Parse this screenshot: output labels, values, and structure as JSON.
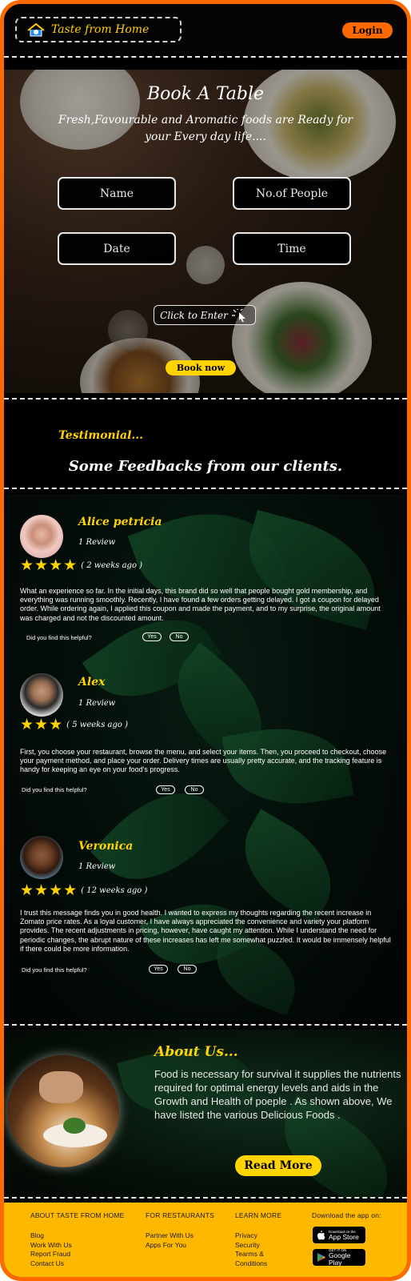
{
  "header": {
    "brand": "Taste from Home",
    "login": "Login"
  },
  "booking": {
    "title": "Book A Table",
    "subtitle": "Fresh,Favourable and Aromatic foods are Ready for your Every day life....",
    "fields": {
      "name": "Name",
      "people": "No.of People",
      "date": "Date",
      "time": "Time"
    },
    "enter": "Click to Enter",
    "book": "Book now"
  },
  "testimonial": {
    "label": "Testimonial...",
    "title": "Some Feedbacks from our clients.",
    "helpful_q": "Did you find this helpful?",
    "yes": "Yes",
    "no": "No",
    "reviews": [
      {
        "name": "Alice petricia",
        "count": "1 Review",
        "stars": 4,
        "time": "( 2 weeks ago )",
        "text": "What an experience so far. In the initial days, this brand did so well that people bought gold membership, and everything was running smoothly.  Recently, I have found a few orders getting delayed. I got a coupon for delayed order. While ordering again, I applied this coupon and made the payment, and to my surprise, the original amount was charged and not the discounted amount."
      },
      {
        "name": "Alex",
        "count": "1 Review",
        "stars": 3,
        "time": "( 5 weeks ago )",
        "text": " First, you choose your restaurant, browse the menu, and select your items. Then, you proceed to checkout, choose your payment method, and place your order. Delivery times are usually pretty accurate, and the tracking feature is handy for keeping an eye on your food's progress."
      },
      {
        "name": "Veronica",
        "count": "1 Review",
        "stars": 4,
        "time": "( 12 weeks ago )",
        "text": "I trust this message finds you in good health. I wanted to express my thoughts regarding the recent increase in Zomato price rates. As a loyal customer, I have always appreciated the convenience and variety your platform provides. The recent adjustments in pricing, however, have caught my attention. While I understand the need for periodic changes, the abrupt nature of these increases has left me somewhat puzzled. It would be immensely helpful if there could be more information."
      }
    ]
  },
  "about": {
    "title": "About Us...",
    "text": "Food  is necessary for survival it supplies the nutrients required for optimal energy levels and aids in the Growth and Health of poeple . As shown above, We have listed the various Delicious Foods .",
    "button": "Read More"
  },
  "footer": {
    "col1": {
      "heading": "ABOUT TASTE FROM HOME",
      "links": [
        "Blog",
        "Work With Us",
        "Report Fraud",
        "Contact Us"
      ]
    },
    "col2": {
      "heading": "FOR RESTAURANTS",
      "links": [
        "Partner With Us",
        "Apps For You"
      ]
    },
    "col3": {
      "heading": "LEARN MORE",
      "links": [
        "Privacy",
        "Security",
        "Tearms &",
        "Conditions"
      ]
    },
    "app_heading": "Download the app on:",
    "appstore": {
      "small": "Download on the",
      "big": "App Store"
    },
    "googleplay": {
      "small": "GET IT ON",
      "big": "Google Play"
    }
  },
  "colors": {
    "frame": "#ff6a00",
    "accent": "#ffd400",
    "footer": "#ffb800"
  },
  "icons": [
    "home-logo-icon",
    "cursor-click-icon",
    "star-icon",
    "apple-icon",
    "google-play-icon"
  ]
}
